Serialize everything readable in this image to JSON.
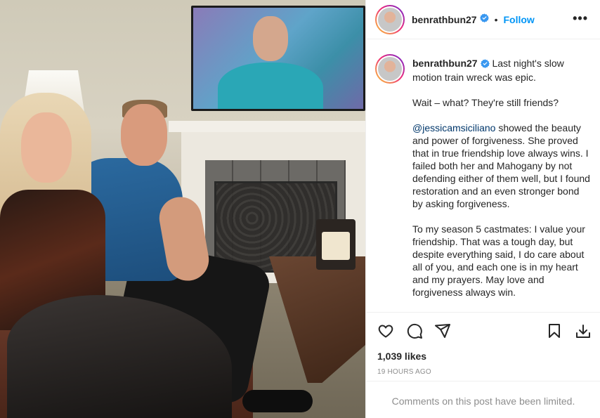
{
  "photo": {
    "alt": ""
  },
  "header": {
    "username": "benrathbun27",
    "dot": "•",
    "follow_label": "Follow",
    "more_label": "•••"
  },
  "caption": {
    "username": "benrathbun27",
    "line1": "Last night's slow motion train wreck was epic.",
    "para2": "Wait – what? They're still friends?",
    "mention": "@jessicamsiciliano",
    "para3_rest": " showed the beauty and power of forgiveness. She proved that in true friendship love always wins. I failed both her and Mahogany by not defending either of them well, but I found restoration and an even stronger bond by asking forgiveness.",
    "para4": "To my season 5 castmates: I value your friendship. That was a tough day, but despite everything said, I do care about all of you, and each one is in my heart and my prayers. May love and forgiveness always win.",
    "trailing": "."
  },
  "actions": {
    "like_icon": "heart-icon",
    "comment_icon": "comment-icon",
    "share_icon": "paper-plane-icon",
    "save_icon": "bookmark-icon",
    "download_icon": "download-icon"
  },
  "likes_text": "1,039 likes",
  "time_text": "19 HOURS AGO",
  "comments_limited_text": "Comments on this post have been limited.",
  "colors": {
    "link_blue": "#0095f6",
    "mention": "#00376b",
    "muted": "#8e8e8e",
    "verified_blue": "#3897f0"
  }
}
